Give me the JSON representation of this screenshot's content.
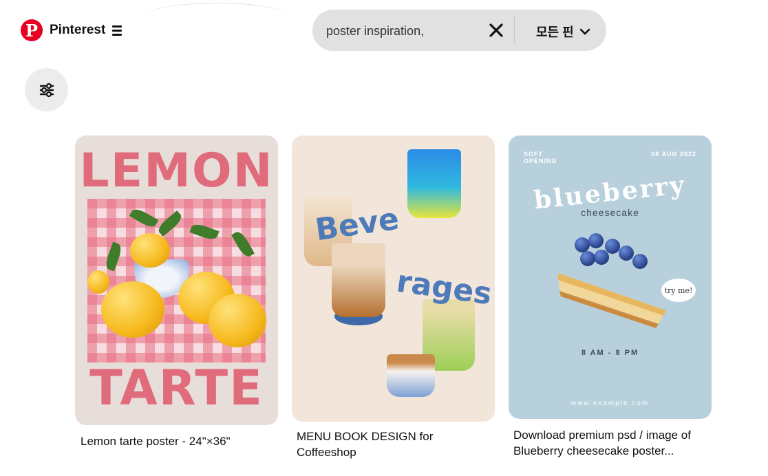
{
  "header": {
    "brand": "Pinterest",
    "logo_glyph": "P",
    "logo_color": "#e60023"
  },
  "search": {
    "value": "poster inspiration,",
    "scope_label": "모든 핀"
  },
  "icons": {
    "menu": "hamburger-menu-icon",
    "clear": "close-icon",
    "dropdown": "chevron-down-icon",
    "filter": "sliders-filter-icon"
  },
  "pins": [
    {
      "title": "Lemon tarte poster - 24\"×36\"",
      "art": {
        "top_word": "LEMON",
        "bottom_word": "TARTE"
      }
    },
    {
      "title": "MENU BOOK DESIGN for Coffeeshop",
      "art": {
        "word_1": "Beve",
        "word_2": "rages"
      }
    },
    {
      "title": "Download premium psd / image of Blueberry cheesecake poster...",
      "art": {
        "soft_opening": "SOFT OPENING",
        "date": "08 AUG 2022",
        "title": "blueberry",
        "subtitle": "cheesecake",
        "badge": "try me!",
        "hours": "8 AM - 8 PM",
        "website": "www.example.com"
      }
    }
  ]
}
